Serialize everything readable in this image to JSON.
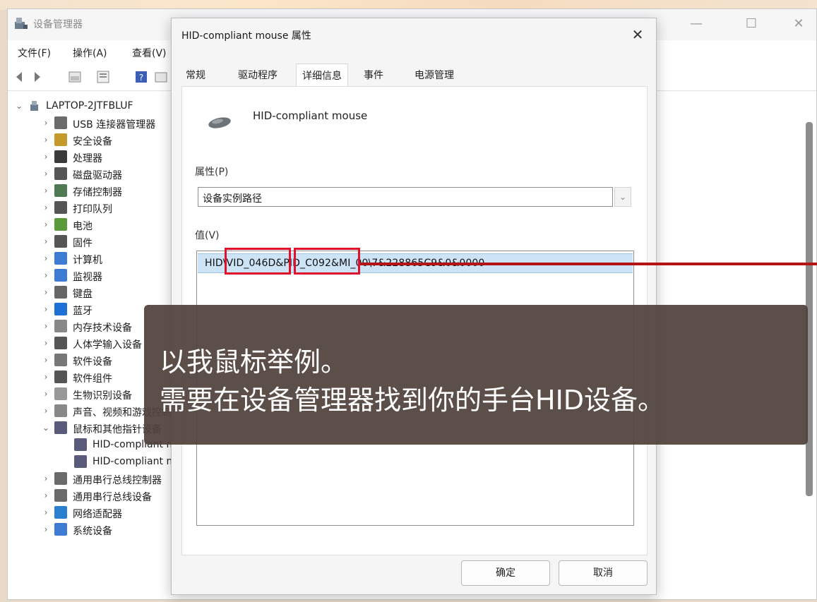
{
  "device_manager": {
    "title": "设备管理器",
    "window_controls": [
      "—",
      "☐",
      "✕"
    ],
    "menu": [
      "文件(F)",
      "操作(A)",
      "查看(V)"
    ],
    "tree_root": "LAPTOP-2JTFBLUF",
    "tree_items": [
      {
        "label": "USB 连接器管理器",
        "caret": "›"
      },
      {
        "label": "安全设备",
        "caret": "›"
      },
      {
        "label": "处理器",
        "caret": "›"
      },
      {
        "label": "磁盘驱动器",
        "caret": "›"
      },
      {
        "label": "存储控制器",
        "caret": "›"
      },
      {
        "label": "打印队列",
        "caret": "›"
      },
      {
        "label": "电池",
        "caret": "›"
      },
      {
        "label": "固件",
        "caret": "›"
      },
      {
        "label": "计算机",
        "caret": "›"
      },
      {
        "label": "监视器",
        "caret": "›"
      },
      {
        "label": "键盘",
        "caret": "›"
      },
      {
        "label": "蓝牙",
        "caret": "›"
      },
      {
        "label": "内存技术设备",
        "caret": "›"
      },
      {
        "label": "人体学输入设备",
        "caret": "›"
      },
      {
        "label": "软件设备",
        "caret": "›"
      },
      {
        "label": "软件组件",
        "caret": "›"
      },
      {
        "label": "生物识别设备",
        "caret": "›"
      },
      {
        "label": "声音、视频和游戏控制器",
        "caret": "›"
      },
      {
        "label": "鼠标和其他指针设备",
        "caret": "⌄"
      },
      {
        "label": "HID-compliant mouse",
        "caret": ""
      },
      {
        "label": "HID-compliant mouse",
        "caret": ""
      },
      {
        "label": "通用串行总线控制器",
        "caret": "›"
      },
      {
        "label": "通用串行总线设备",
        "caret": "›"
      },
      {
        "label": "网络适配器",
        "caret": "›"
      },
      {
        "label": "系统设备",
        "caret": "›"
      }
    ]
  },
  "dialog": {
    "title": "HID-compliant mouse 属性",
    "close": "✕",
    "tabs": [
      "常规",
      "驱动程序",
      "详细信息",
      "事件",
      "电源管理"
    ],
    "active_tab": "详细信息",
    "device_name": "HID-compliant mouse",
    "property_label": "属性(P)",
    "property_value": "设备实例路径",
    "dropdown_arrow": "⌄",
    "value_label": "值(V)",
    "value_text": "HID\\VID_046D&PID_C092&MI_00\\7&228865C9&0&0000",
    "ok_button": "确定",
    "cancel_button": "取消"
  },
  "caption": {
    "line1": "以我鼠标举例。",
    "line2": "需要在设备管理器找到你的手台HID设备。"
  },
  "colors": {
    "highlight": "#e0112b",
    "annotation_line": "#b51416",
    "caption_bg": "#50423c",
    "selection": "#cde3f6"
  }
}
